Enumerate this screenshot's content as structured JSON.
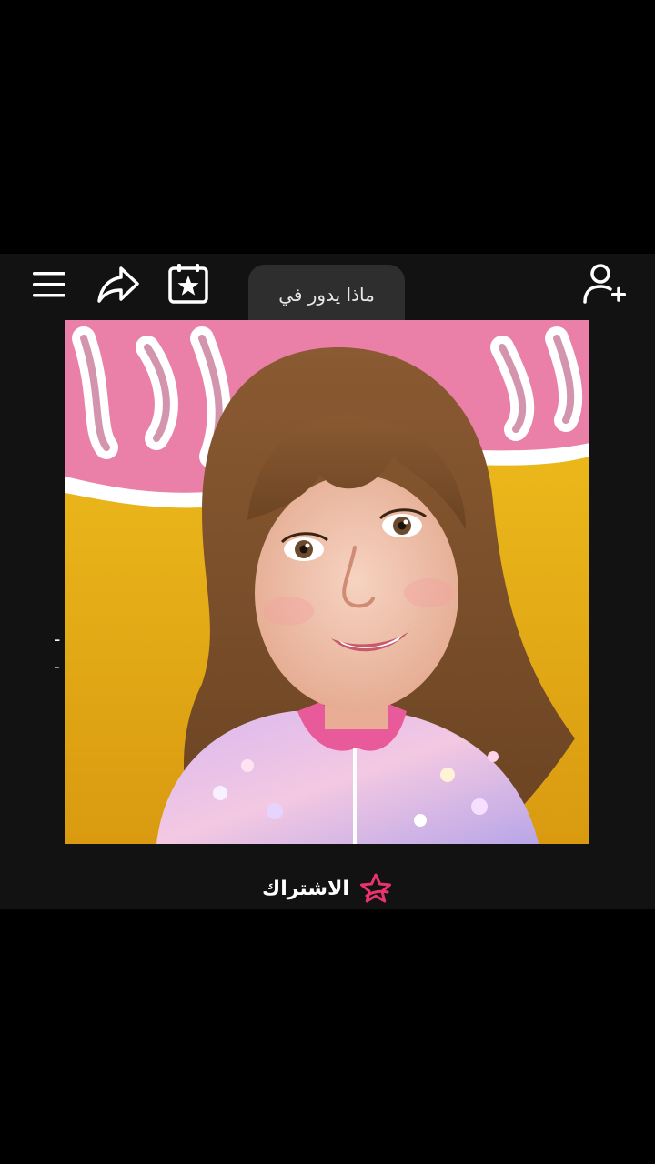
{
  "toolbar": {
    "menu_icon": "hamburger-menu-icon",
    "share_icon": "share-arrow-icon",
    "calendar_icon": "calendar-star-icon",
    "add_user_icon": "add-user-icon"
  },
  "tooltip": {
    "text": "ماذا يدور في"
  },
  "subscribe": {
    "label": "الاشتراك",
    "icon": "pink-star-icon",
    "accent_color": "#e8336e"
  },
  "colors": {
    "panel_background": "#121212",
    "outer_background": "#000000",
    "tooltip_background": "#2e2e2e"
  }
}
